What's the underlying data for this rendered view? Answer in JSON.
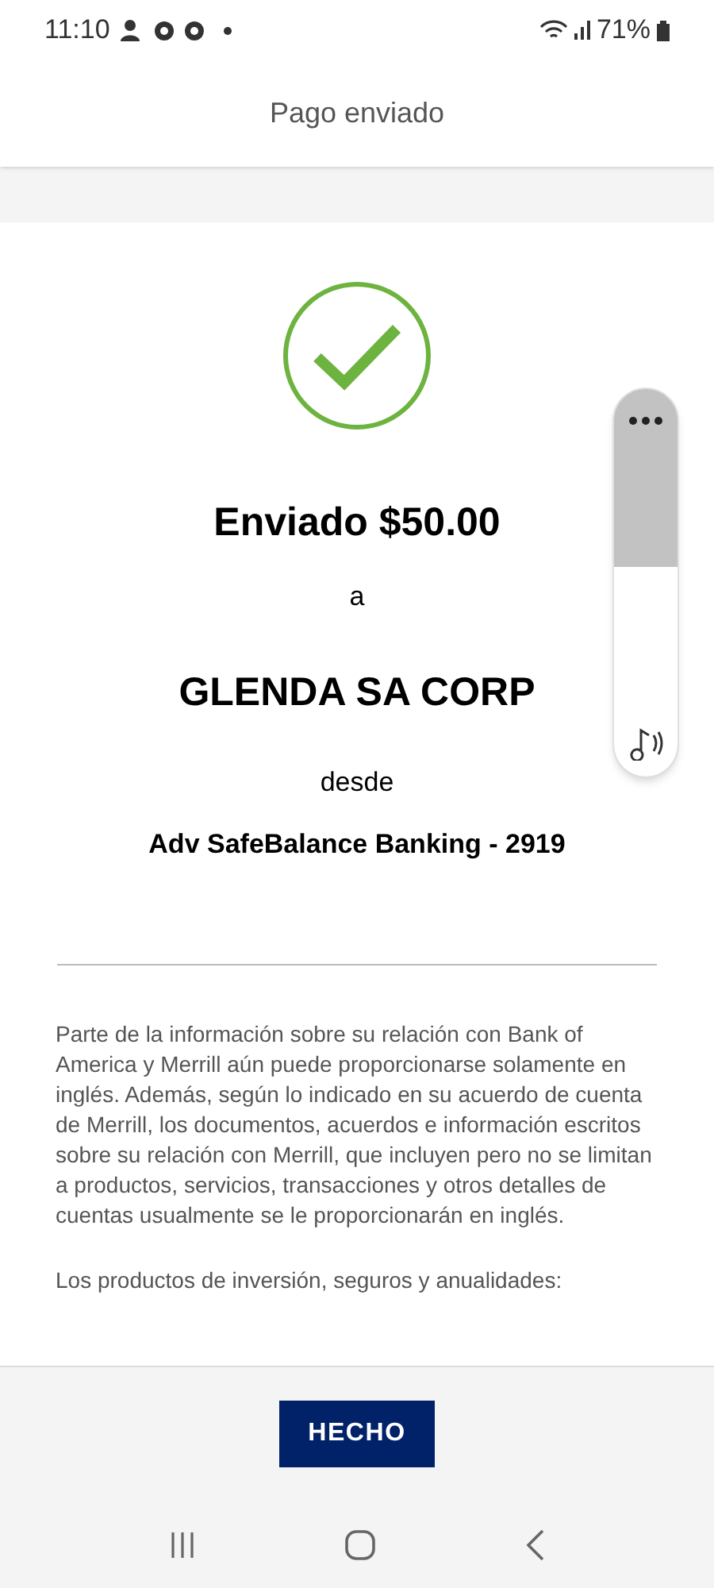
{
  "status_bar": {
    "time": "11:10",
    "battery": "71%"
  },
  "header": {
    "title": "Pago enviado"
  },
  "confirmation": {
    "amount_line": "Enviado $50.00",
    "to_word": "a",
    "recipient": "GLENDA SA CORP",
    "from_word": "desde",
    "account": "Adv SafeBalance Banking - 2919"
  },
  "disclaimer": [
    "Parte de la información sobre su relación con Bank of America y Merrill aún puede proporcionarse solamente en inglés. Además, según lo indicado en su acuerdo de cuenta de Merrill, los documentos, acuerdos e información escritos sobre su relación con Merrill, que incluyen pero no se limitan a productos, servicios, transacciones y otros detalles de cuentas usualmente se le proporcionarán en inglés.",
    "Los productos de inversión, seguros y anualidades:"
  ],
  "done_button": "HECHO",
  "volume_panel": {
    "level": 0.54
  }
}
